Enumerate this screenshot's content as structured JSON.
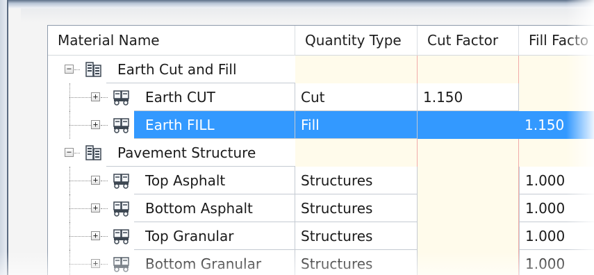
{
  "columns": {
    "material_name": "Material Name",
    "quantity_type": "Quantity Type",
    "cut_factor": "Cut Factor",
    "fill_factor": "Fill Facto"
  },
  "colors": {
    "selection": "#3399ff",
    "cream_column": "#fffbeb",
    "separator_pink": "#f1aaa9"
  },
  "groups": [
    {
      "name": "Earth Cut and Fill",
      "expanded": true,
      "icon": "material-list-icon",
      "items": [
        {
          "name": "Earth CUT",
          "quantity_type": "Cut",
          "cut_factor": "1.150",
          "fill_factor": "",
          "icon": "dump-truck-icon",
          "selected": false
        },
        {
          "name": "Earth FILL",
          "quantity_type": "Fill",
          "cut_factor": "",
          "fill_factor": "1.150",
          "icon": "dump-truck-icon",
          "selected": true
        }
      ]
    },
    {
      "name": "Pavement Structure",
      "expanded": true,
      "icon": "material-list-icon",
      "items": [
        {
          "name": "Top Asphalt",
          "quantity_type": "Structures",
          "cut_factor": "",
          "fill_factor": "1.000",
          "icon": "dump-truck-icon",
          "selected": false
        },
        {
          "name": "Bottom Asphalt",
          "quantity_type": "Structures",
          "cut_factor": "",
          "fill_factor": "1.000",
          "icon": "dump-truck-icon",
          "selected": false
        },
        {
          "name": "Top Granular",
          "quantity_type": "Structures",
          "cut_factor": "",
          "fill_factor": "1.000",
          "icon": "dump-truck-icon",
          "selected": false
        },
        {
          "name": "Bottom Granular",
          "quantity_type": "Structures",
          "cut_factor": "",
          "fill_factor": "1.000",
          "icon": "dump-truck-icon",
          "selected": false
        }
      ]
    }
  ]
}
